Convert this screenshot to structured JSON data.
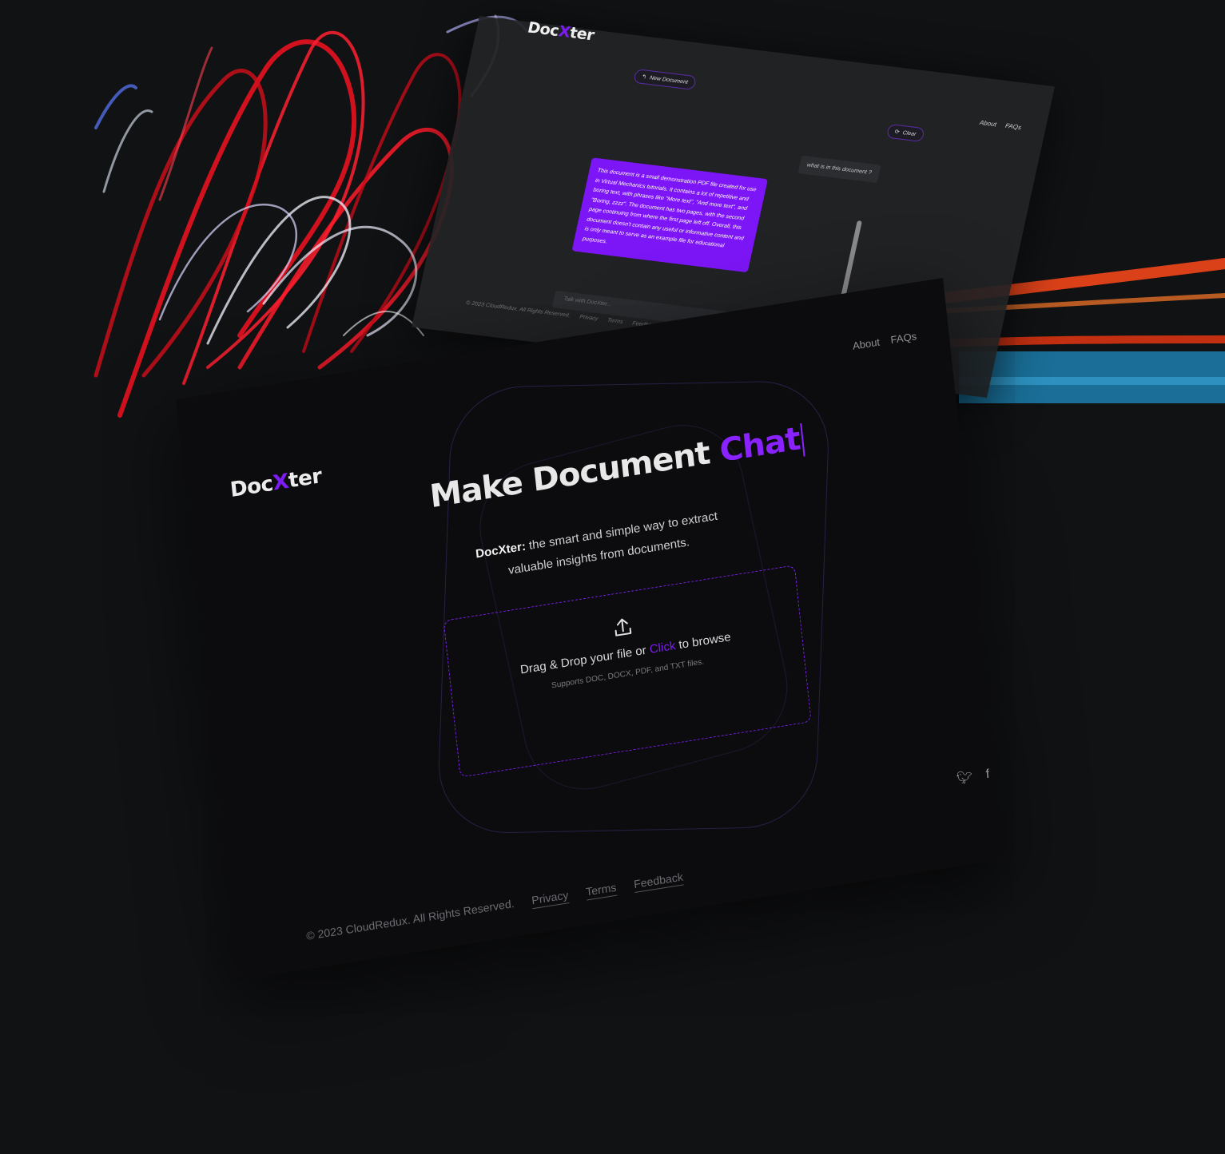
{
  "back_screen": {
    "logo": {
      "part1": "Doc",
      "part2": "X",
      "part3": "ter"
    },
    "nav": [
      "About",
      "FAQs"
    ],
    "new_document_label": "New Document",
    "clear_label": "Clear",
    "user_message": "what is in this document ?",
    "ai_message": "This document is a small demonstration PDF file created for use in Virtual Mechanics tutorials. It contains a lot of repetitive and boring text, with phrases like \"More text\", \"And more text\", and \"Boring, zzzz\". The document has two pages, with the second page continuing from where the first page left off. Overall, this document doesn't contain any useful or informative content and is only meant to serve as an example file for educational purposes.",
    "input_placeholder": "Talk with DocXter...",
    "footer": {
      "copyright": "© 2023 CloudRedux. All Rights Reserved.",
      "links": [
        "Privacy",
        "Terms",
        "Feedback"
      ]
    },
    "social_icons": [
      "github-icon",
      "twitter-icon",
      "facebook-icon",
      "discord-icon",
      "reddit-icon"
    ]
  },
  "front_screen": {
    "logo": {
      "part1": "Doc",
      "part2": "X",
      "part3": "ter"
    },
    "nav": [
      "About",
      "FAQs"
    ],
    "headline": {
      "main": "Make Document",
      "accent": "Chat"
    },
    "tagline": {
      "brand": "DocXter:",
      "text": " the smart and simple way to extract valuable insights from documents."
    },
    "dropzone": {
      "line_before": "Drag & Drop your file or ",
      "click_label": "Click",
      "line_after": " to browse",
      "supported": "Supports DOC, DOCX, PDF, and TXT files."
    },
    "social_icons": [
      "twitter-icon",
      "facebook-icon"
    ],
    "footer": {
      "copyright": "© 2023 CloudRedux. All Rights Reserved.",
      "links": [
        "Privacy",
        "Terms",
        "Feedback"
      ]
    }
  },
  "colors": {
    "accent": "#7d1cf2",
    "background": "#111214",
    "panel": "#0c0c0e"
  }
}
